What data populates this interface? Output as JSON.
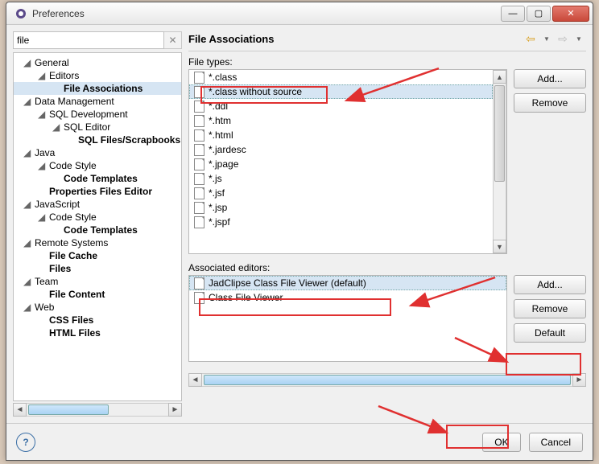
{
  "window": {
    "title": "Preferences"
  },
  "filter": {
    "value": "file"
  },
  "tree": [
    {
      "label": "General",
      "depth": 0,
      "expanded": true
    },
    {
      "label": "Editors",
      "depth": 1,
      "expanded": true
    },
    {
      "label": "File Associations",
      "depth": 2,
      "bold": true,
      "selected": true
    },
    {
      "label": "Data Management",
      "depth": 0,
      "expanded": true
    },
    {
      "label": "SQL Development",
      "depth": 1,
      "expanded": true
    },
    {
      "label": "SQL Editor",
      "depth": 2,
      "expanded": true
    },
    {
      "label": "SQL Files/Scrapbooks",
      "depth": 3,
      "bold": true
    },
    {
      "label": "Java",
      "depth": 0,
      "expanded": true
    },
    {
      "label": "Code Style",
      "depth": 1,
      "expanded": true
    },
    {
      "label": "Code Templates",
      "depth": 2,
      "bold": true
    },
    {
      "label": "Properties Files Editor",
      "depth": 1,
      "bold": true
    },
    {
      "label": "JavaScript",
      "depth": 0,
      "expanded": true
    },
    {
      "label": "Code Style",
      "depth": 1,
      "expanded": true
    },
    {
      "label": "Code Templates",
      "depth": 2,
      "bold": true
    },
    {
      "label": "Remote Systems",
      "depth": 0,
      "expanded": true
    },
    {
      "label": "File Cache",
      "depth": 1,
      "bold": true
    },
    {
      "label": "Files",
      "depth": 1,
      "bold": true
    },
    {
      "label": "Team",
      "depth": 0,
      "expanded": true
    },
    {
      "label": "File Content",
      "depth": 1,
      "bold": true
    },
    {
      "label": "Web",
      "depth": 0,
      "expanded": true
    },
    {
      "label": "CSS Files",
      "depth": 1,
      "bold": true
    },
    {
      "label": "HTML Files",
      "depth": 1,
      "bold": true
    }
  ],
  "page": {
    "title": "File Associations",
    "filetypes_label": "File types:",
    "editors_label": "Associated editors:",
    "buttons": {
      "add": "Add...",
      "remove": "Remove",
      "default": "Default"
    }
  },
  "filetypes": [
    {
      "label": "*.class"
    },
    {
      "label": "*.class without source",
      "selected": true
    },
    {
      "label": "*.ddl"
    },
    {
      "label": "*.htm"
    },
    {
      "label": "*.html"
    },
    {
      "label": "*.jardesc"
    },
    {
      "label": "*.jpage"
    },
    {
      "label": "*.js"
    },
    {
      "label": "*.jsf"
    },
    {
      "label": "*.jsp"
    },
    {
      "label": "*.jspf"
    }
  ],
  "editors": [
    {
      "label": "JadClipse Class File Viewer (default)",
      "selected": true
    },
    {
      "label": "Class File Viewer"
    }
  ],
  "footer": {
    "ok": "OK",
    "cancel": "Cancel"
  }
}
